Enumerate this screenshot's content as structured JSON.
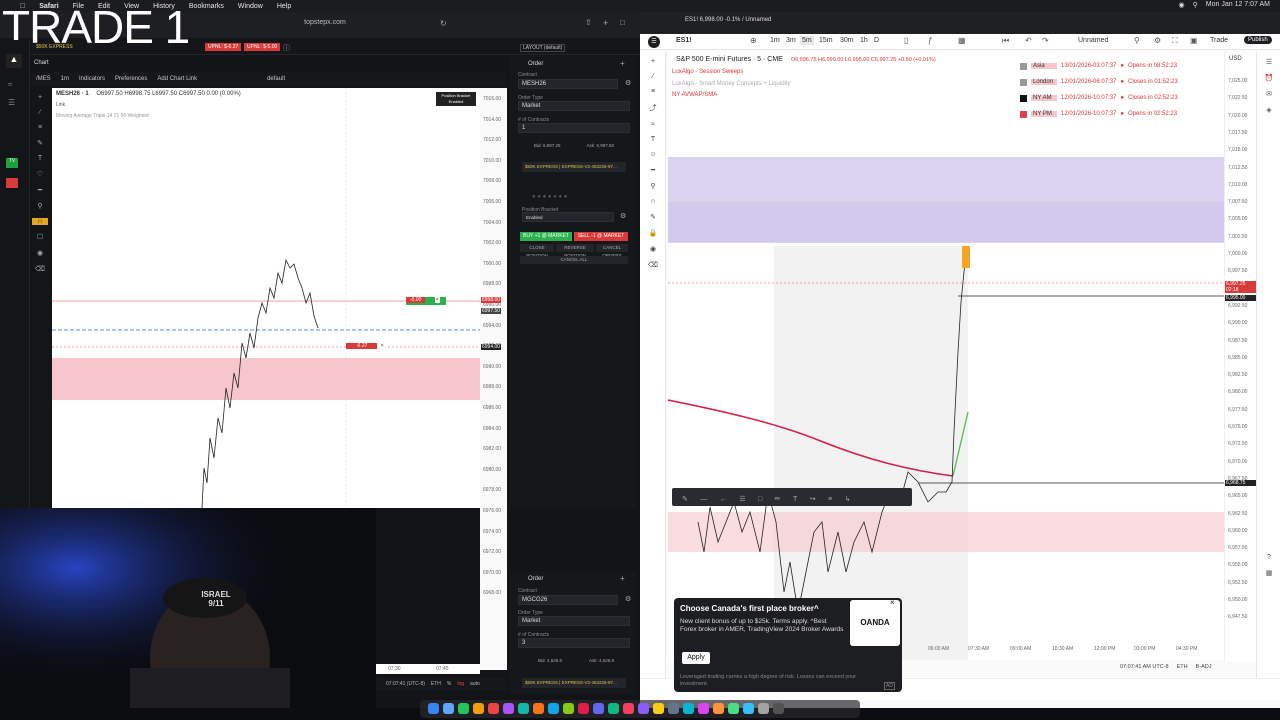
{
  "overlay_title": "TRADE 1",
  "menubar": {
    "app": "Safari",
    "items": [
      "File",
      "Edit",
      "View",
      "History",
      "Bookmarks",
      "Window",
      "Help"
    ],
    "clock": "Mon Jan 12  7:07 AM"
  },
  "safari": {
    "url": "topstepx.com"
  },
  "topstep": {
    "account_label": "$50K EXPRESS",
    "upnl_label": "UPNL: $-6.27",
    "rpnl_label": "UPNL: $-5.00",
    "layout_label": "LAYOUT (default)",
    "chart_tab": "Chart",
    "symbol_search": "/MES",
    "timeframe": "1m",
    "indicators_label": "Indicators",
    "preferences_label": "Preferences",
    "add_chart_link": "Add Chart Link",
    "template_label": "default",
    "chart_symbol": "MESH26 · 1",
    "chart_ohlc": "O6997.50  H6998.75  L6997.50  C6997.50  0.00 (0.00%)",
    "chart_link": "Link",
    "ma_label": "Moving Average Triple 14 21 50 Weighted",
    "position_bracket": "Position Bracket",
    "position_bracket_state": "Enabled",
    "price_ticks": [
      "7016.00",
      "7014.00",
      "7012.00",
      "7010.00",
      "7008.00",
      "7006.00",
      "7004.00",
      "7002.00",
      "7000.00",
      "6998.00",
      "6996.00",
      "6994.00",
      "6992.00",
      "6990.00",
      "6988.00",
      "6986.00",
      "6984.00",
      "6982.00",
      "6980.00",
      "6978.00",
      "6976.00",
      "6974.00",
      "6972.00",
      "6970.00",
      "6968.00"
    ],
    "price_current": "6997.50",
    "price_stop": "6994.00",
    "price_target": "6998.00",
    "target_order_tag": "-5.00",
    "stop_order_tag": "-6.27",
    "time_ticks": [
      "07:30",
      "07:45"
    ],
    "bottom_time": "07:07:41 (UTC-8)",
    "bottom_eth": "ETH",
    "bottom_pct": "%",
    "bottom_log": "log",
    "bottom_auto": "auto"
  },
  "order_panel": {
    "tab": "Order",
    "contract_label": "Contract",
    "contract_value": "MESH26",
    "order_type_label": "Order Type",
    "order_type_value": "Market",
    "contracts_label": "# of Contracts",
    "contracts_value": "1",
    "bid": "Bid: 6,997.25",
    "ask": "Ask: 6,997.50",
    "account": "$50K EXPRESS | EXPRESS-V2-453226-97...",
    "risk_label": "Position Bracket",
    "risk_value": "Enabled",
    "buy_button": "BUY +1 @ MARKET",
    "sell_button": "SELL -1 @ MARKET",
    "close_button": "CLOSE POSITION",
    "reverse_button": "REVERSE POSITION",
    "cancel_orders_button": "CANCEL ORDERS",
    "cancel_all_button": "CANCEL ALL"
  },
  "order_panel2": {
    "tab": "Order",
    "contract_label": "Contract",
    "contract_value": "MGCG26",
    "order_type_label": "Order Type",
    "order_type_value": "Market",
    "contracts_label": "# of Contracts",
    "contracts_value": "3",
    "bid": "Bid: 4,626.5",
    "ask": "Ask: 4,626.8",
    "account": "$50K EXPRESS | EXPRESS-V2-453226-97..."
  },
  "tradingview": {
    "symbol": "ES1!",
    "tab_title": "ES1! 6,998.00 -0.1% / Unnamed",
    "timeframes": [
      "1m",
      "3m",
      "5m",
      "15m",
      "30m",
      "1h",
      "D"
    ],
    "active_timeframe": "5m",
    "layout_name": "Unnamed",
    "trade_button": "Trade",
    "publish_button": "Publish",
    "title": "S&P 500 E-mini Futures · 5 · CME",
    "ohlc": "O6,996.75  H6,999.00  L6,995.00  C6,997.25  +0.50 (+0.01%)",
    "indicator1": "LuxAlgo - Session Sweeps",
    "indicator2": "LuxAlgo - Smart Money Concepts + Liquidity",
    "indicator3": "NY AVWAP/SMA",
    "currency": "USD",
    "sessions": [
      {
        "name": "Asia",
        "date": "13/01/2026-03:07:37",
        "status": "Opens in 08:52:23",
        "color": "#9a9a9a"
      },
      {
        "name": "London",
        "date": "12/01/2026-06:07:37",
        "status": "Closes in 01:52:23",
        "color": "#9a9a9a"
      },
      {
        "name": "NY AM",
        "date": "12/01/2026-10:07:37",
        "status": "Closes in 02:52:23",
        "color": "#111111"
      },
      {
        "name": "NY PM",
        "date": "12/01/2026-10:07:37",
        "status": "Opens in 02:52:23",
        "color": "#e04050"
      }
    ],
    "price_ticks": [
      "7,025.00",
      "7,022.50",
      "7,020.00",
      "7,017.50",
      "7,015.00",
      "7,012.50",
      "7,010.00",
      "7,007.50",
      "7,005.00",
      "7,002.50",
      "7,000.00",
      "6,997.50",
      "6,995.00",
      "6,992.50",
      "6,990.00",
      "6,987.50",
      "6,985.00",
      "6,982.50",
      "6,980.00",
      "6,977.50",
      "6,975.00",
      "6,972.50",
      "6,970.00",
      "6,967.50",
      "6,965.00",
      "6,962.50",
      "6,960.00",
      "6,957.50",
      "6,955.00",
      "6,952.50",
      "6,950.00",
      "6,947.50"
    ],
    "price_tag_current": "6,997.25",
    "price_tag_countdown": "02:18",
    "price_tag_level": "6,995.00",
    "price_tag_low": "6,968.75",
    "time_ticks": [
      "06:00 AM",
      "07:30 AM",
      "09:00 AM",
      "10:30 AM",
      "12:00 PM",
      "03:00 PM",
      "04:30 PM"
    ],
    "status_time": "07:07:41 AM UTC-8",
    "status_eth": "ETH",
    "status_badj": "B-ADJ"
  },
  "ad": {
    "title": "Choose Canada's first place broker^",
    "body": "New client bonus of up to $25k. Terms apply. ^Best Forex broker in AMER, TradingView 2024 Broker Awards",
    "apply": "Apply",
    "disclaimer": "Leveraged trading carries a high degree of risk. Losses can exceed your investment.",
    "brand": "OANDA",
    "ad_badge": "AD"
  },
  "webcam": {
    "cap_text": "ISRAEL 9/11"
  },
  "colors": {
    "green": "#2bb24c",
    "red": "#d83a3a",
    "zone_red": "#f6c6cc",
    "zone_purple": "#d7cdee",
    "avwap": "#d0244a",
    "orange": "#f5a524"
  }
}
